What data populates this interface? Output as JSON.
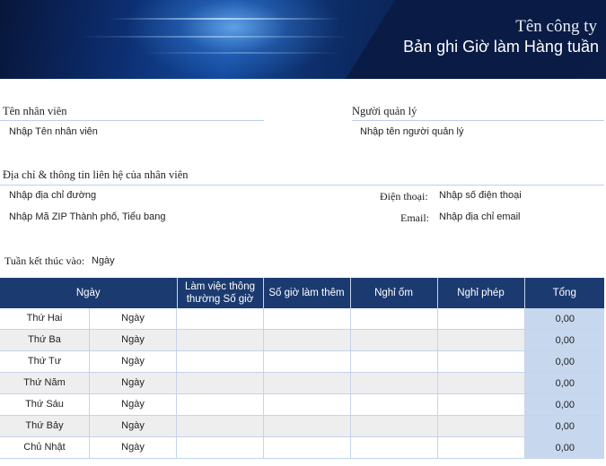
{
  "header": {
    "company": "Tên công ty",
    "title": "Bản ghi Giờ làm Hàng tuần"
  },
  "employee": {
    "name_label": "Tên nhân viên",
    "name_value": "Nhập Tên nhân viên",
    "manager_label": "Người quản lý",
    "manager_value": "Nhập tên người quản lý",
    "address_label": "Địa chỉ & thông tin liên hệ của nhân viên",
    "street_value": "Nhập địa chỉ đường",
    "city_value": "Nhập Mã ZIP Thành phố, Tiểu bang",
    "phone_label": "Điện thoại:",
    "phone_value": "Nhập số điện thoại",
    "email_label": "Email:",
    "email_value": "Nhập địa chỉ email"
  },
  "week": {
    "label": "Tuần kết thúc vào:",
    "value": "Ngày"
  },
  "table": {
    "headers": [
      "Ngày",
      "Làm việc thông thường  Số giờ",
      "Số giờ làm thêm",
      "Nghỉ ốm",
      "Nghỉ phép",
      "Tổng"
    ],
    "rows": [
      {
        "day": "Thứ Hai",
        "date": "Ngày",
        "total": "0,00"
      },
      {
        "day": "Thứ Ba",
        "date": "Ngày",
        "total": "0,00"
      },
      {
        "day": "Thứ Tư",
        "date": "Ngày",
        "total": "0,00"
      },
      {
        "day": "Thứ Năm",
        "date": "Ngày",
        "total": "0,00"
      },
      {
        "day": "Thứ Sáu",
        "date": "Ngày",
        "total": "0,00"
      },
      {
        "day": "Thứ Bảy",
        "date": "Ngày",
        "total": "0,00"
      },
      {
        "day": "Chủ Nhật",
        "date": "Ngày",
        "total": "0,00"
      }
    ]
  }
}
